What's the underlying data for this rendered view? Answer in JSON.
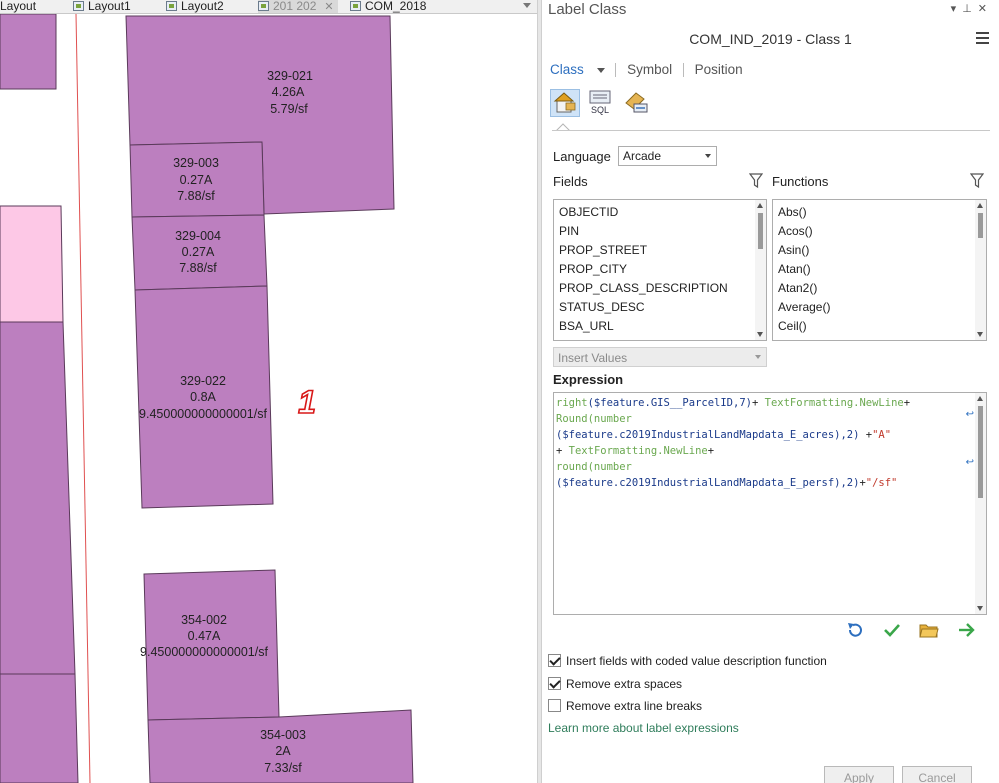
{
  "tabs": [
    {
      "label": "Layout",
      "active": false
    },
    {
      "label": "Layout1",
      "active": false
    },
    {
      "label": "Layout2",
      "active": false
    },
    {
      "label": "201 202",
      "active": true
    },
    {
      "label": "COM_2018",
      "active": false
    }
  ],
  "map": {
    "parcels": [
      {
        "id": "329-021",
        "line2": "4.26A",
        "line3": "5.79/sf"
      },
      {
        "id": "329-003",
        "line2": "0.27A",
        "line3": "7.88/sf"
      },
      {
        "id": "329-004",
        "line2": "0.27A",
        "line3": "7.88/sf"
      },
      {
        "id": "329-022",
        "line2": "0.8A",
        "line3": "9.450000000000001/sf"
      },
      {
        "id": "354-002",
        "line2": "0.47A",
        "line3": "9.450000000000001/sf"
      },
      {
        "id": "354-003",
        "line2": "2A",
        "line3": "7.33/sf"
      }
    ],
    "annotation": "1",
    "colors": {
      "parcel": "#bc7fbf",
      "parcel_light": "#fdc8e6",
      "road_line": "#e05050",
      "annotation": "#d81818"
    }
  },
  "pane": {
    "title": "Label Class",
    "class_title": "COM_IND_2019 - Class 1",
    "subnav": {
      "class": "Class",
      "symbol": "Symbol",
      "position": "Position"
    },
    "tools": [
      "label-class-icon",
      "sql-query-icon",
      "label-placement-icon"
    ],
    "sql_text": "SQL",
    "language_label": "Language",
    "language_value": "Arcade",
    "fields_label": "Fields",
    "functions_label": "Functions",
    "fields": [
      "OBJECTID",
      "PIN",
      "PROP_STREET",
      "PROP_CITY",
      "PROP_CLASS_DESCRIPTION",
      "STATUS_DESC",
      "BSA_URL"
    ],
    "functions": [
      "Abs()",
      "Acos()",
      "Asin()",
      "Atan()",
      "Atan2()",
      "Average()",
      "Ceil()"
    ],
    "insert_values": "Insert Values",
    "expression_label": "Expression",
    "expression": {
      "l1_fn": "right",
      "l1_var": "($feature.GIS__ParcelID,7)",
      "l1_op": "+ ",
      "l1_tf": "TextFormatting.NewLine",
      "l1_end": "+",
      "l2_fn": "Round",
      "l2_fn2": "(number",
      "l3_var": "($feature.c2019IndustrialLandMapdata_E_acres),2)",
      "l3_op": " +",
      "l3_str": "\"A\"",
      "l4_op": "+ ",
      "l4_tf": "TextFormatting.NewLine",
      "l4_end": "+",
      "l5_fn": "round",
      "l5_fn2": "(number",
      "l6_var": "($feature.c2019IndustrialLandMapdata_E_persf),2)",
      "l6_op": "+",
      "l6_str": "\"/sf\""
    },
    "actions": [
      "undo-icon",
      "verify-icon",
      "open-folder-icon",
      "export-arrow-icon"
    ],
    "checkboxes": [
      {
        "label": "Insert fields with coded value description function",
        "checked": true
      },
      {
        "label": "Remove extra spaces",
        "checked": true
      },
      {
        "label": "Remove extra line breaks",
        "checked": false
      }
    ],
    "learn_link": "Learn more about label expressions",
    "apply": "Apply",
    "cancel": "Cancel"
  }
}
